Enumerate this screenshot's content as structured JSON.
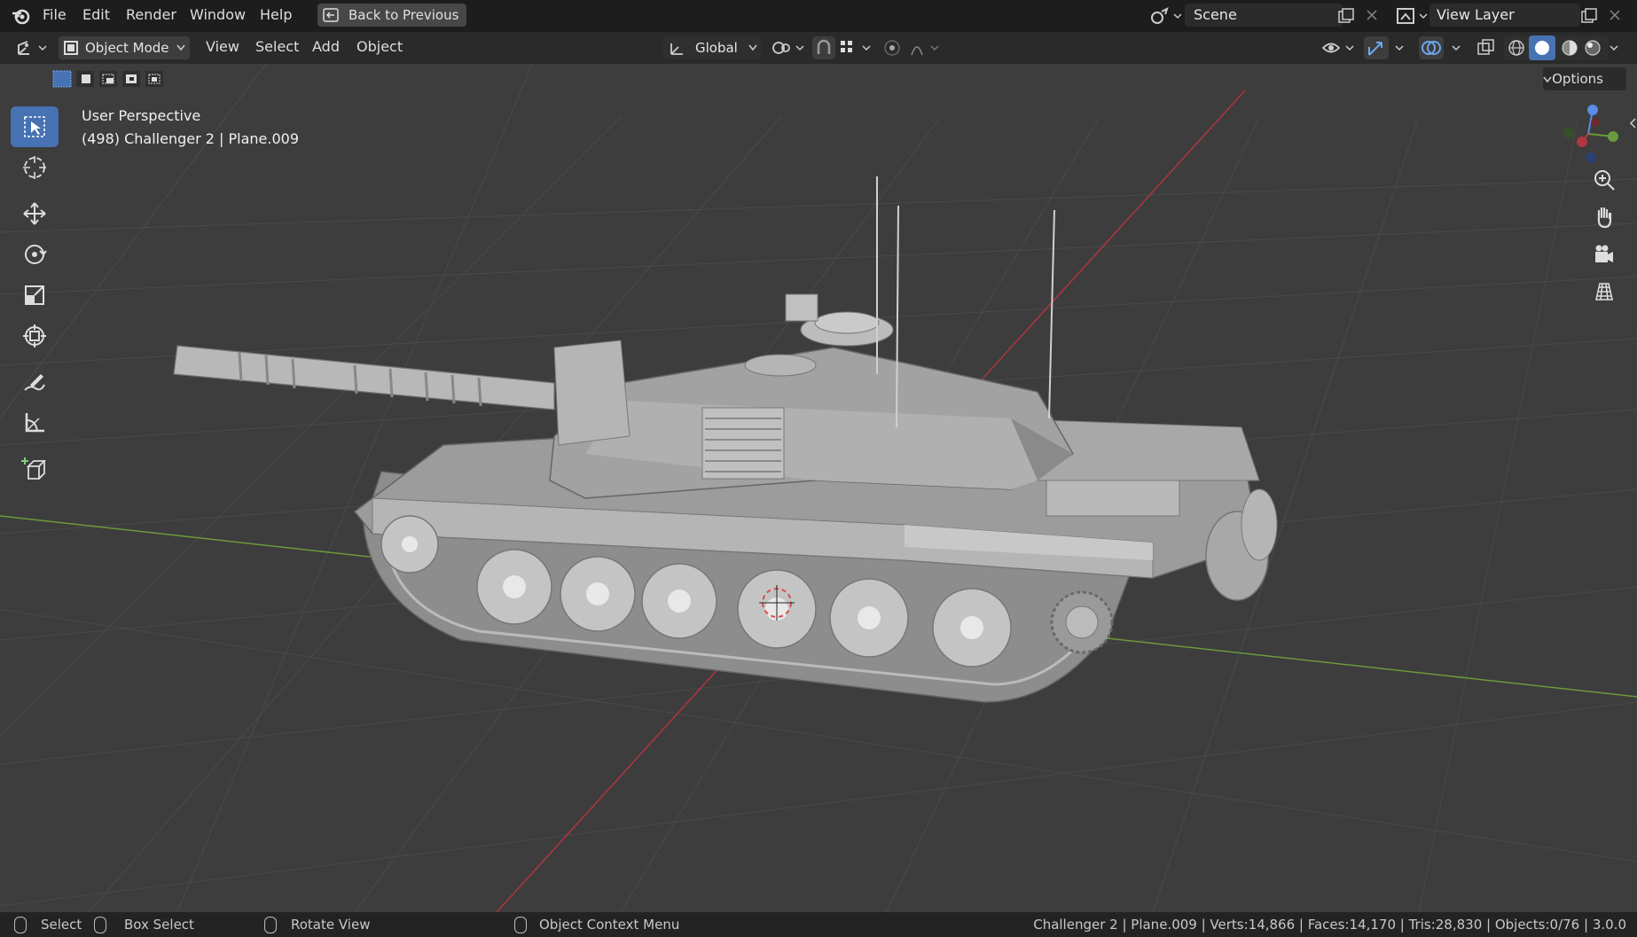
{
  "app": {
    "menu": [
      "File",
      "Edit",
      "Render",
      "Window",
      "Help"
    ],
    "back_button": "Back to Previous",
    "scene": "Scene",
    "view_layer": "View Layer"
  },
  "header": {
    "mode": "Object Mode",
    "menus": [
      "View",
      "Select",
      "Add",
      "Object"
    ],
    "orientation": "Global",
    "options": "Options"
  },
  "viewport": {
    "view_name": "User Perspective",
    "object_info": "(498) Challenger 2 | Plane.009"
  },
  "tools": [
    "select-box",
    "cursor",
    "move",
    "rotate",
    "scale",
    "transform",
    "annotate",
    "measure",
    "add-cube"
  ],
  "statusbar": {
    "select": "Select",
    "box_select": "Box Select",
    "rotate_view": "Rotate View",
    "context_menu": "Object Context Menu",
    "stats": "Challenger 2 | Plane.009 | Verts:14,866 | Faces:14,170 | Tris:28,830 | Objects:0/76 | 3.0.0"
  },
  "colors": {
    "accent": "#4772b3",
    "x_axis": "#b0363f",
    "y_axis": "#6a9a3c",
    "viewport_bg": "#3d3d3d"
  }
}
